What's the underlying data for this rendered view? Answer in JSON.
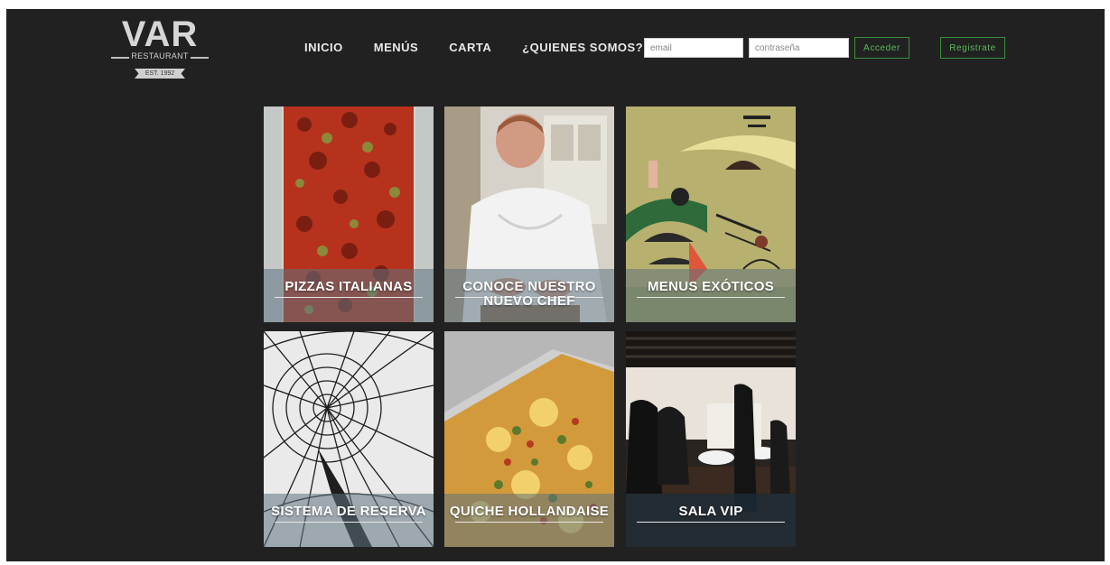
{
  "logo": {
    "title": "VAR",
    "subtitle": "RESTAURANT",
    "est": "EST. 1992"
  },
  "nav": {
    "items": [
      "INICIO",
      "MENÚS",
      "CARTA",
      "¿QUIENES SOMOS?"
    ]
  },
  "login": {
    "email_placeholder": "email",
    "password_placeholder": "contraseña",
    "submit_label": "Acceder",
    "register_label": "Registrate"
  },
  "tiles": [
    {
      "caption": "PIZZAS ITALIANAS",
      "image": "pizza-photo"
    },
    {
      "caption": "CONOCE NUESTRO NUEVO CHEF",
      "image": "chef-photo"
    },
    {
      "caption": "MENUS EXÓTICOS",
      "image": "abstract-art"
    },
    {
      "caption": "SISTEMA DE RESERVA",
      "image": "tower-structure-photo"
    },
    {
      "caption": "QUICHE HOLLANDAISE",
      "image": "quiche-photo"
    },
    {
      "caption": "SALA VIP",
      "image": "restaurant-room-photo"
    }
  ],
  "colors": {
    "background": "#212121",
    "accent": "#5cb85c",
    "caption_overlay": "#5f737d"
  }
}
